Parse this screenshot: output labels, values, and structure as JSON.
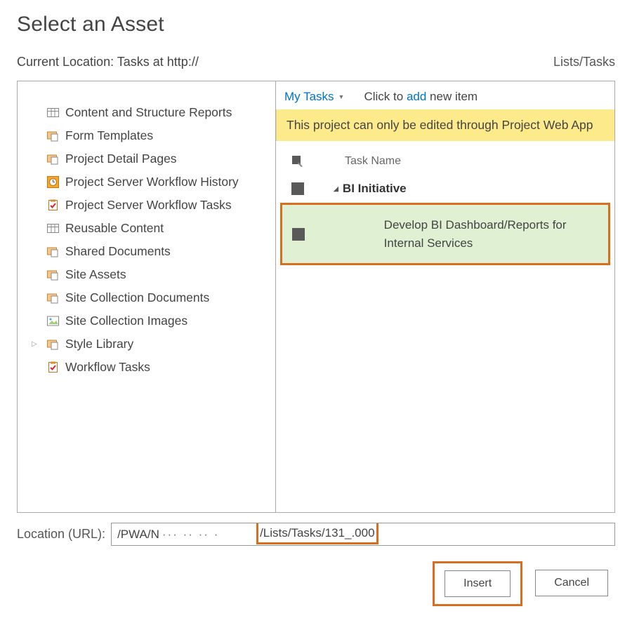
{
  "dialog": {
    "title": "Select an Asset",
    "location_label": "Current Location:",
    "location_value": "Tasks at http://",
    "location_suffix": "Lists/Tasks"
  },
  "tree": {
    "items": [
      {
        "icon": "grid",
        "label": "Content and Structure Reports"
      },
      {
        "icon": "folder",
        "label": "Form Templates"
      },
      {
        "icon": "folder",
        "label": "Project Detail Pages"
      },
      {
        "icon": "history",
        "label": "Project Server Workflow History"
      },
      {
        "icon": "check",
        "label": "Project Server Workflow Tasks"
      },
      {
        "icon": "grid",
        "label": "Reusable Content"
      },
      {
        "icon": "folder",
        "label": "Shared Documents"
      },
      {
        "icon": "folder",
        "label": "Site Assets"
      },
      {
        "icon": "folder",
        "label": "Site Collection Documents"
      },
      {
        "icon": "image",
        "label": "Site Collection Images"
      },
      {
        "icon": "folder",
        "label": "Style Library",
        "expandable": true
      },
      {
        "icon": "check",
        "label": "Workflow Tasks"
      }
    ]
  },
  "right": {
    "my_tasks": "My Tasks",
    "click_to": "Click to",
    "add": "add",
    "new_item": "new item",
    "banner": "This project can only be edited through Project Web App",
    "task_name_header": "Task Name",
    "bi_initiative": "BI Initiative",
    "selected_task": "Develop BI Dashboard/Reports for Internal Services"
  },
  "footer": {
    "url_label": "Location (URL):",
    "url_seg1": "/PWA/N",
    "url_dots": "··· ··  ·· ·",
    "url_highlight": "/Lists/Tasks/131_.000",
    "insert": "Insert",
    "cancel": "Cancel"
  },
  "icons": {
    "grid": "grid-icon",
    "folder": "folder-doc-icon",
    "history": "clock-icon",
    "check": "clipboard-check-icon",
    "image": "picture-icon"
  }
}
